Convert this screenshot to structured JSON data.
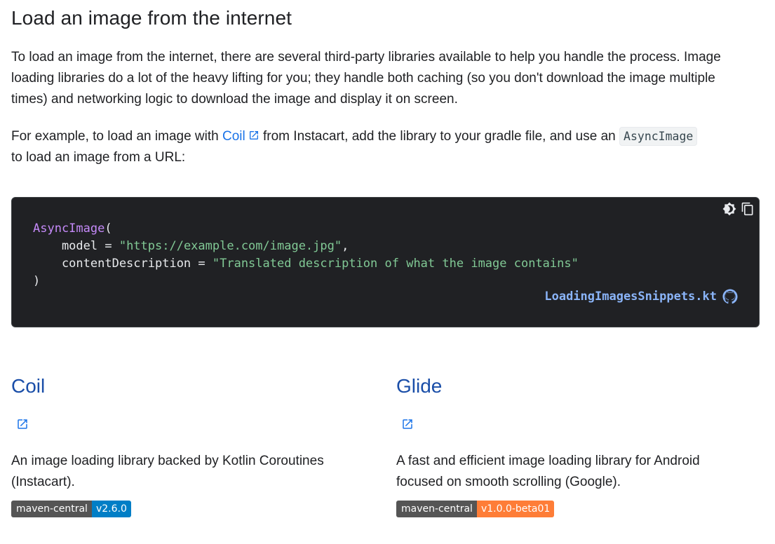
{
  "section": {
    "title": "Load an image from the internet",
    "intro": "To load an image from the internet, there are several third-party libraries available to help you handle the process. Image loading libraries do a lot of the heavy lifting for you; they handle both caching (so you don't download the image multiple times) and networking logic to download the image and display it on screen.",
    "example_prefix": "For example, to load an image with ",
    "example_link": "Coil",
    "example_middle": " from Instacart, add the library to your gradle file, and use an ",
    "example_code": "AsyncImage",
    "example_suffix": "to load an image from a URL:"
  },
  "code_block": {
    "line1_fn": "AsyncImage",
    "line1_paren": "(",
    "line2_key": "    model = ",
    "line2_val": "\"https://example.com/image.jpg\"",
    "line2_comma": ",",
    "line3_key": "    contentDescription = ",
    "line3_val": "\"Translated description of what the image contains\"",
    "line4": ")",
    "snippet_file": "LoadingImagesSnippets.kt",
    "tool_icons": [
      "dark-mode-toggle-icon",
      "copy-icon"
    ]
  },
  "libraries": [
    {
      "name": "Coil",
      "description": "An image loading library backed by Kotlin Coroutines (Instacart).",
      "badge_label": "maven-central",
      "badge_version": "v2.6.0",
      "badge_color": "#007ec6"
    },
    {
      "name": "Glide",
      "description": "A fast and efficient image loading library for Android focused on smooth scrolling (Google).",
      "badge_label": "maven-central",
      "badge_version": "v1.0.0-beta01",
      "badge_color": "#fe7d37"
    }
  ],
  "colors": {
    "link": "#1a73e8",
    "heading_link": "#1a4ea8",
    "code_bg": "#202124",
    "code_fn": "#c58af9",
    "code_string": "#81c995",
    "snippet_link": "#8ab4f8"
  }
}
